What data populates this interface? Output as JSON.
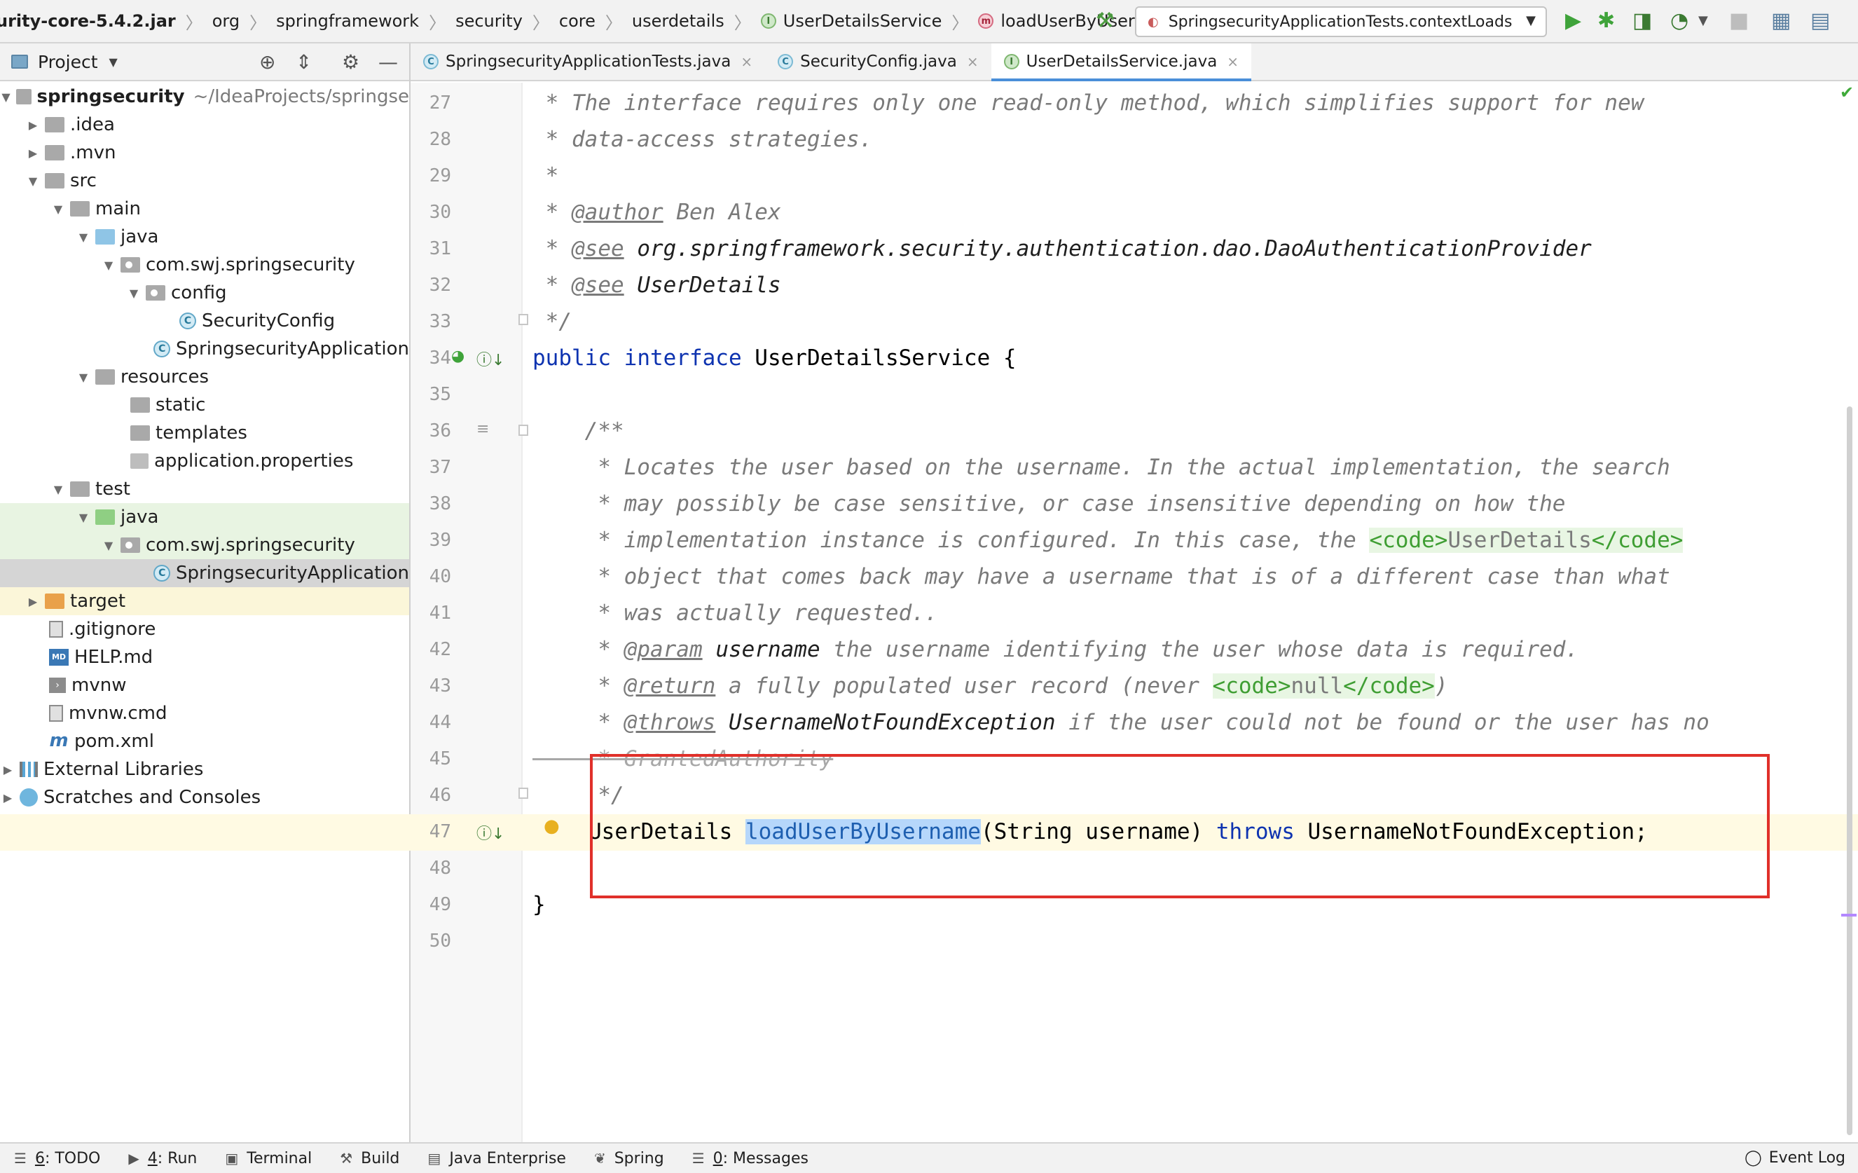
{
  "breadcrumbs": [
    {
      "label": "urity-core-5.4.2.jar",
      "icon": ""
    },
    {
      "label": "org",
      "icon": ""
    },
    {
      "label": "springframework",
      "icon": ""
    },
    {
      "label": "security",
      "icon": ""
    },
    {
      "label": "core",
      "icon": ""
    },
    {
      "label": "userdetails",
      "icon": ""
    },
    {
      "label": "UserDetailsService",
      "icon": "interface-icon"
    },
    {
      "label": "loadUserByUsername",
      "icon": "method-icon"
    }
  ],
  "run_config": {
    "label": "SpringsecurityApplicationTests.contextLoads"
  },
  "project_panel": {
    "title": "Project"
  },
  "tree": {
    "root_label": "springsecurity",
    "root_path": "~/IdeaProjects/springse",
    "idea": ".idea",
    "mvn": ".mvn",
    "src": "src",
    "main": "main",
    "java_main": "java",
    "pkg_main": "com.swj.springsecurity",
    "config": "config",
    "security_config": "SecurityConfig",
    "app_main": "SpringsecurityApplication",
    "resources": "resources",
    "static": "static",
    "templates": "templates",
    "app_props": "application.properties",
    "test": "test",
    "java_test": "java",
    "pkg_test": "com.swj.springsecurity",
    "app_test": "SpringsecurityApplication",
    "target": "target",
    "gitignore": ".gitignore",
    "help": "HELP.md",
    "mvnw": "mvnw",
    "mvnw_cmd": "mvnw.cmd",
    "pom": "pom.xml",
    "ext_libs": "External Libraries",
    "scratches": "Scratches and Consoles"
  },
  "tabs": [
    {
      "label": "SpringsecurityApplicationTests.java",
      "icon": "class-icon"
    },
    {
      "label": "SecurityConfig.java",
      "icon": "class-icon"
    },
    {
      "label": "UserDetailsService.java",
      "icon": "interface-icon"
    }
  ],
  "code": {
    "lines": {
      "l27": {
        "n": "27",
        "t": " * The interface requires only one read-only method, which simplifies support for new"
      },
      "l28": {
        "n": "28",
        "t": " * data-access strategies."
      },
      "l29": {
        "n": "29",
        "t": " *"
      },
      "l30": {
        "n": "30",
        "a": " * ",
        "tag": "@author",
        "b": " Ben Alex"
      },
      "l31": {
        "n": "31",
        "a": " * ",
        "tag": "@see",
        "b": " ",
        "ref": "org.springframework.security.authentication.dao.DaoAuthenticationProvider"
      },
      "l32": {
        "n": "32",
        "a": " * ",
        "tag": "@see",
        "b": " ",
        "ref": "UserDetails"
      },
      "l33": {
        "n": "33",
        "t": " */"
      },
      "l34": {
        "n": "34",
        "kw1": "public",
        "kw2": "interface",
        "rest": " UserDetailsService {"
      },
      "l35": {
        "n": "35"
      },
      "l36": {
        "n": "36",
        "t": "    /**"
      },
      "l37": {
        "n": "37",
        "t": "     * Locates the user based on the username. In the actual implementation, the search"
      },
      "l38": {
        "n": "38",
        "t": "     * may possibly be case sensitive, or case insensitive depending on how the"
      },
      "l39": {
        "n": "39",
        "a": "     * implementation instance is configured. In this case, the ",
        "h1": "<code>",
        "m": "UserDetails",
        "h2": "</code>"
      },
      "l40": {
        "n": "40",
        "t": "     * object that comes back may have a username that is of a different case than what"
      },
      "l41": {
        "n": "41",
        "t": "     * was actually requested.."
      },
      "l42": {
        "n": "42",
        "a": "     * ",
        "tag": "@param",
        "b": " ",
        "p": "username",
        "c": " the username identifying the user whose data is required."
      },
      "l43": {
        "n": "43",
        "a": "     * ",
        "tag": "@return",
        "b": " a fully populated user record (never ",
        "h1": "<code>",
        "m": "null",
        "h2": "</code>",
        "c": ")"
      },
      "l44": {
        "n": "44",
        "a": "     * ",
        "tag": "@throws",
        "b": " ",
        "ref": "UsernameNotFoundException",
        "c": " if the user could not be found or the user has no"
      },
      "l45": {
        "n": "45",
        "t": "     * GrantedAuthority"
      },
      "l46": {
        "n": "46",
        "t": "     */"
      },
      "l47": {
        "n": "47",
        "a": "UserDetails ",
        "hl": "loadUserByUsername",
        "b": "(String username) ",
        "kw": "throws",
        "c": " UsernameNotFoundException;"
      },
      "l48": {
        "n": "48"
      },
      "l49": {
        "n": "49",
        "t": "}"
      },
      "l50": {
        "n": "50"
      }
    }
  },
  "bottom": {
    "todo_num": "6",
    "todo_label": ": TODO",
    "run_num": "4",
    "run_label": ": Run",
    "terminal": "Terminal",
    "build": "Build",
    "java_enterprise": "Java Enterprise",
    "spring": "Spring",
    "messages_num": "0",
    "messages_label": ": Messages",
    "event_log": "Event Log"
  },
  "colors": {
    "keyword": "#0e33b0",
    "doc_comment": "#7a7a7a",
    "html_tag": "#3f9e33",
    "selection": "#b6d7fb",
    "annotation_box": "#e0302a",
    "active_tab": "#4a8fd9"
  }
}
